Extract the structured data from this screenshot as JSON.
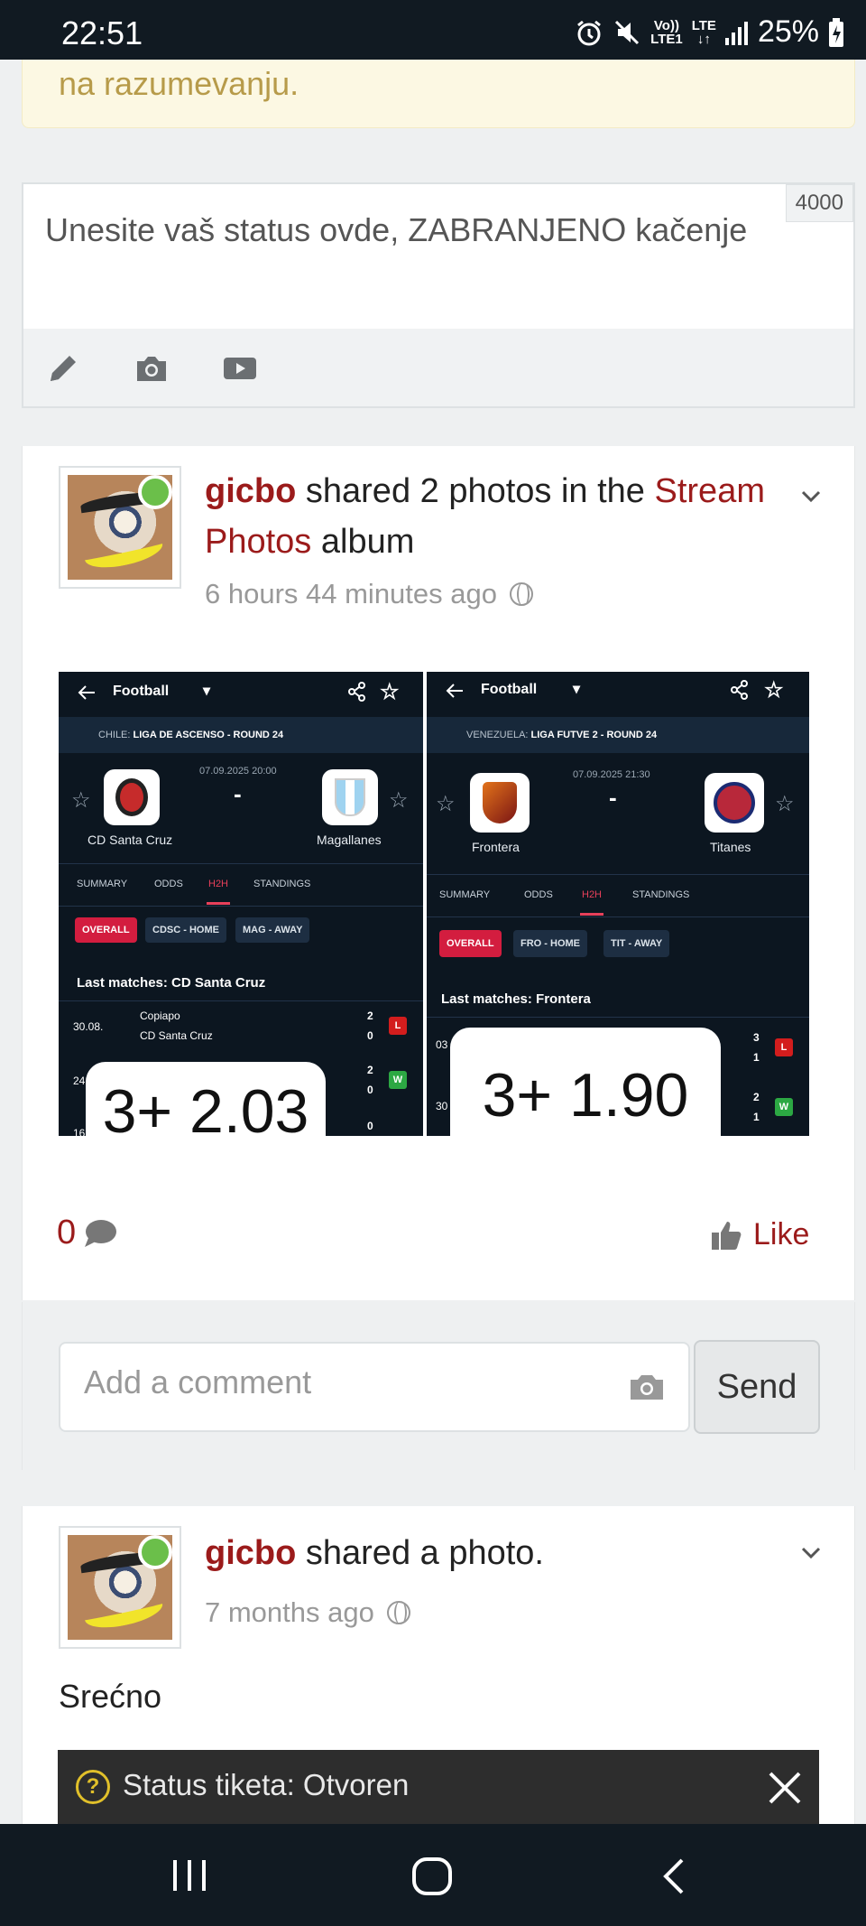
{
  "status_bar": {
    "time": "22:51",
    "volte_top": "Vo))",
    "volte_bottom": "LTE1",
    "network": "LTE",
    "battery": "25%"
  },
  "notice": {
    "text": "na razumevanju."
  },
  "composer": {
    "counter": "4000",
    "placeholder": "Unesite vaš status ovde, ZABRANJENO kačenje"
  },
  "post1": {
    "user": "gicbo",
    "action_text": " shared 2 photos in the ",
    "album": "Stream Photos",
    "album_suffix": " album",
    "time": "6 hours 44 minutes ago",
    "comment_count": "0",
    "like_label": "Like",
    "photos": [
      {
        "sport": "Football",
        "league_prefix": "CHILE: ",
        "league": "LIGA DE ASCENSO - ROUND 24",
        "date": "07.09.2025 20:00",
        "home": "CD Santa Cruz",
        "away": "Magallanes",
        "tabs": [
          "SUMMARY",
          "ODDS",
          "H2H",
          "STANDINGS"
        ],
        "chips": [
          "OVERALL",
          "CDSC - HOME",
          "MAG - AWAY"
        ],
        "last_matches": "Last matches: CD Santa Cruz",
        "row_date": "30.08.",
        "row_team1": "Copiapo",
        "row_team2": "CD Santa Cruz",
        "row_score1": "2",
        "row_score2": "0",
        "row_res": "L",
        "row2_date": "24",
        "row2_s1": "2",
        "row2_s2": "0",
        "row2_res": "W",
        "row3_date": "16",
        "row3_s1": "0",
        "odds": "3+ 2.03"
      },
      {
        "sport": "Football",
        "league_prefix": "VENEZUELA: ",
        "league": "LIGA FUTVE 2 - ROUND 24",
        "date": "07.09.2025 21:30",
        "home": "Frontera",
        "away": "Titanes",
        "tabs": [
          "SUMMARY",
          "ODDS",
          "H2H",
          "STANDINGS"
        ],
        "chips": [
          "OVERALL",
          "FRO - HOME",
          "TIT - AWAY"
        ],
        "last_matches": "Last matches: Frontera",
        "row_date": "03",
        "row_score1": "3",
        "row_score2": "1",
        "row_res": "L",
        "row2_date": "30",
        "row2_s1": "2",
        "row2_s2": "1",
        "row2_res": "W",
        "odds": "3+ 1.90"
      }
    ]
  },
  "comment": {
    "placeholder": "Add a comment",
    "send_label": "Send"
  },
  "post2": {
    "user": "gicbo",
    "action_text": " shared a photo.",
    "time": "7 months ago",
    "text": "Srećno"
  },
  "ticket": {
    "icon": "?",
    "text": "Status tiketa: Otvoren"
  },
  "colors": {
    "accent": "#9b1b1b",
    "online": "#6bbf4a",
    "banner_bg": "#fcf8e3"
  }
}
